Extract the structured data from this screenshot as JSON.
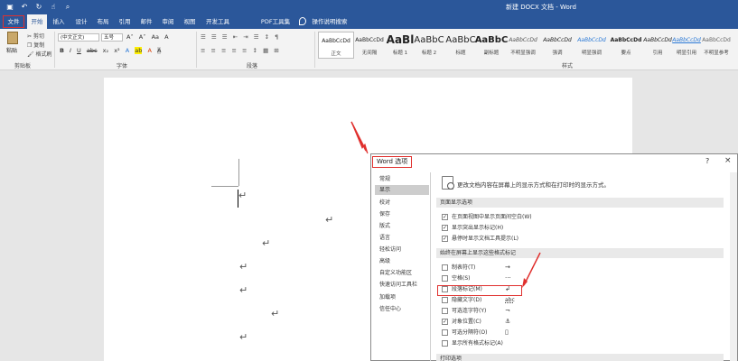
{
  "window": {
    "title": "新建 DOCX 文档 - Word"
  },
  "qat": {
    "save_icon": "save-icon",
    "undo_icon": "undo-icon",
    "redo_icon": "redo-icon",
    "touch_icon": "touch-mode-icon",
    "preview_icon": "print-preview-icon"
  },
  "tabs": [
    {
      "label": "文件"
    },
    {
      "label": "开始"
    },
    {
      "label": "插入"
    },
    {
      "label": "设计"
    },
    {
      "label": "布局"
    },
    {
      "label": "引用"
    },
    {
      "label": "邮件"
    },
    {
      "label": "审阅"
    },
    {
      "label": "视图"
    },
    {
      "label": "开发工具"
    },
    {
      "label": "PDF工具集"
    },
    {
      "label": "操作说明搜索"
    }
  ],
  "clipboard": {
    "paste": "粘贴",
    "cut": "剪切",
    "copy": "复制",
    "format_painter": "格式刷",
    "group": "剪贴板"
  },
  "font": {
    "name": "(中文正文)",
    "size": "五号",
    "group": "字体",
    "grow": "A˄",
    "shrink": "A˅",
    "case": "Aa",
    "clear": "A",
    "bold": "B",
    "italic": "I",
    "underline": "U",
    "strike": "abc",
    "sub": "x₂",
    "sup": "x²",
    "effects": "A",
    "highlight": "ab",
    "color": "A",
    "shade": "A"
  },
  "paragraph": {
    "group": "段落",
    "row1": "☰ ☰ ☰ ⇤ ⇥ ☰ ↕ ¶",
    "row2": "≡ ≡ ≡ ≡ ≡ ↕ ▦ ⊞"
  },
  "styles": {
    "group": "样式",
    "items": [
      {
        "sample": "AaBbCcDd",
        "name": "正文"
      },
      {
        "sample": "AaBbCcDd",
        "name": "无间隔"
      },
      {
        "sample": "AaBl",
        "name": "标题 1"
      },
      {
        "sample": "AaBbC",
        "name": "标题 2"
      },
      {
        "sample": "AaBbC",
        "name": "标题"
      },
      {
        "sample": "AaBbC",
        "name": "副标题"
      },
      {
        "sample": "AaBbCcDd",
        "name": "不明显强调"
      },
      {
        "sample": "AaBbCcDd",
        "name": "强调"
      },
      {
        "sample": "AaBbCcDd",
        "name": "明显强调"
      },
      {
        "sample": "AaBbCcDd",
        "name": "要点"
      },
      {
        "sample": "AaBbCcDd",
        "name": "引用"
      },
      {
        "sample": "AaBbCcDd",
        "name": "明显引用"
      },
      {
        "sample": "AaBbCcDd",
        "name": "不明显参考"
      }
    ]
  },
  "document": {
    "paragraph_mark": "↵"
  },
  "dialog": {
    "title": "Word 选项",
    "help": "?",
    "close": "×",
    "nav": [
      "常规",
      "显示",
      "校对",
      "保存",
      "版式",
      "语言",
      "轻松访问",
      "高级",
      "自定义功能区",
      "快速访问工具栏",
      "加载项",
      "信任中心"
    ],
    "intro": "更改文档内容在屏幕上的显示方式和在打印时的显示方式。",
    "section1": "页面显示选项",
    "section1_options": [
      {
        "text": "在页面视图中显示页面间空白(W)",
        "checked": "✓"
      },
      {
        "text": "显示突出显示标记(H)",
        "checked": "✓"
      },
      {
        "text": "悬停时显示文档工具提示(L)",
        "checked": "✓"
      }
    ],
    "section2": "始终在屏幕上显示这些格式标记",
    "section2_options": [
      {
        "text": "制表符(T)",
        "symbol": "→",
        "checked": ""
      },
      {
        "text": "空格(S)",
        "symbol": "···",
        "checked": ""
      },
      {
        "text": "段落标记(M)",
        "symbol": "↲",
        "checked": ""
      },
      {
        "text": "隐藏文字(D)",
        "symbol": "abc",
        "checked": ""
      },
      {
        "text": "可选连字符(Y)",
        "symbol": "¬",
        "checked": ""
      },
      {
        "text": "对象位置(C)",
        "symbol": "⚓",
        "checked": "✓"
      },
      {
        "text": "可选分隔符(O)",
        "symbol": "▯",
        "checked": ""
      },
      {
        "text": "显示所有格式标记(A)",
        "symbol": "",
        "checked": ""
      }
    ],
    "section3": "打印选项"
  }
}
